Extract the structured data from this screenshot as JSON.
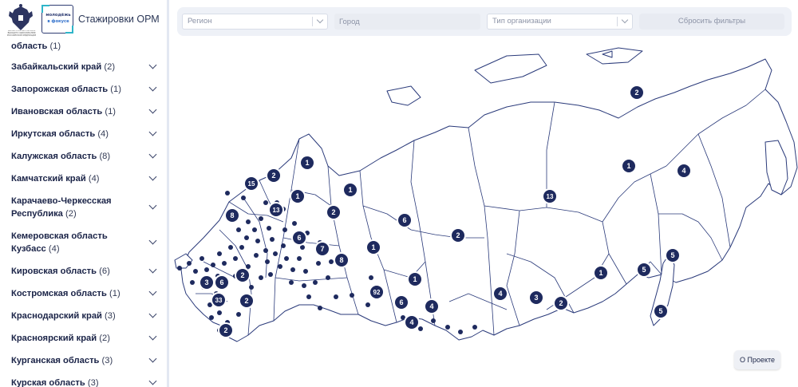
{
  "header": {
    "emblem_caption": "МИНИСТЕРСТВО НАУКИ И ВЫСШЕГО ОБРАЗОВАНИЯ РОССИЙСКОЙ ФЕДЕРАЦИИ",
    "logo_top": "молодёжь",
    "logo_bottom": "в фокусе",
    "title": "Стажировки ОРМ"
  },
  "sidebar": {
    "items": [
      {
        "name": "область",
        "count": "(1)"
      },
      {
        "name": "Забайкальский край",
        "count": "(2)"
      },
      {
        "name": "Запорожская область",
        "count": "(1)"
      },
      {
        "name": "Ивановская область",
        "count": "(1)"
      },
      {
        "name": "Иркутская область",
        "count": "(4)"
      },
      {
        "name": "Калужская область",
        "count": "(8)"
      },
      {
        "name": "Камчатский край",
        "count": "(4)"
      },
      {
        "name": "Карачаево-Черкесская Республика",
        "count": "(2)"
      },
      {
        "name": "Кемеровская область Кузбасс",
        "count": "(4)"
      },
      {
        "name": "Кировская область",
        "count": "(6)"
      },
      {
        "name": "Костромская область",
        "count": "(1)"
      },
      {
        "name": "Краснодарский край",
        "count": "(3)"
      },
      {
        "name": "Красноярский край",
        "count": "(2)"
      },
      {
        "name": "Курганская область",
        "count": "(3)"
      },
      {
        "name": "Курская область",
        "count": "(3)"
      }
    ]
  },
  "filters": {
    "region_placeholder": "Регион",
    "city_placeholder": "Город",
    "org_type_placeholder": "Тип организации",
    "reset_label": "Сбросить фильтры"
  },
  "map": {
    "markers": [
      {
        "label": "2"
      },
      {
        "label": "1"
      },
      {
        "label": "4"
      },
      {
        "label": "13"
      },
      {
        "label": "1"
      },
      {
        "label": "2"
      },
      {
        "label": "15"
      },
      {
        "label": "1"
      },
      {
        "label": "1"
      },
      {
        "label": "13"
      },
      {
        "label": "8"
      },
      {
        "label": "2"
      },
      {
        "label": "6"
      },
      {
        "label": "6"
      },
      {
        "label": "7"
      },
      {
        "label": "8"
      },
      {
        "label": "1"
      },
      {
        "label": "2"
      },
      {
        "label": "2"
      },
      {
        "label": "3"
      },
      {
        "label": "6"
      },
      {
        "label": "92"
      },
      {
        "label": "1"
      },
      {
        "label": "33"
      },
      {
        "label": "2"
      },
      {
        "label": "6"
      },
      {
        "label": "4"
      },
      {
        "label": "4"
      },
      {
        "label": "4"
      },
      {
        "label": "3"
      },
      {
        "label": "2"
      },
      {
        "label": "1"
      },
      {
        "label": "5"
      },
      {
        "label": "5"
      },
      {
        "label": "5"
      },
      {
        "label": "2"
      }
    ],
    "marker_color": "#1e2a5e",
    "outline_color": "#2a3a7a"
  },
  "about_label": "О Проекте"
}
